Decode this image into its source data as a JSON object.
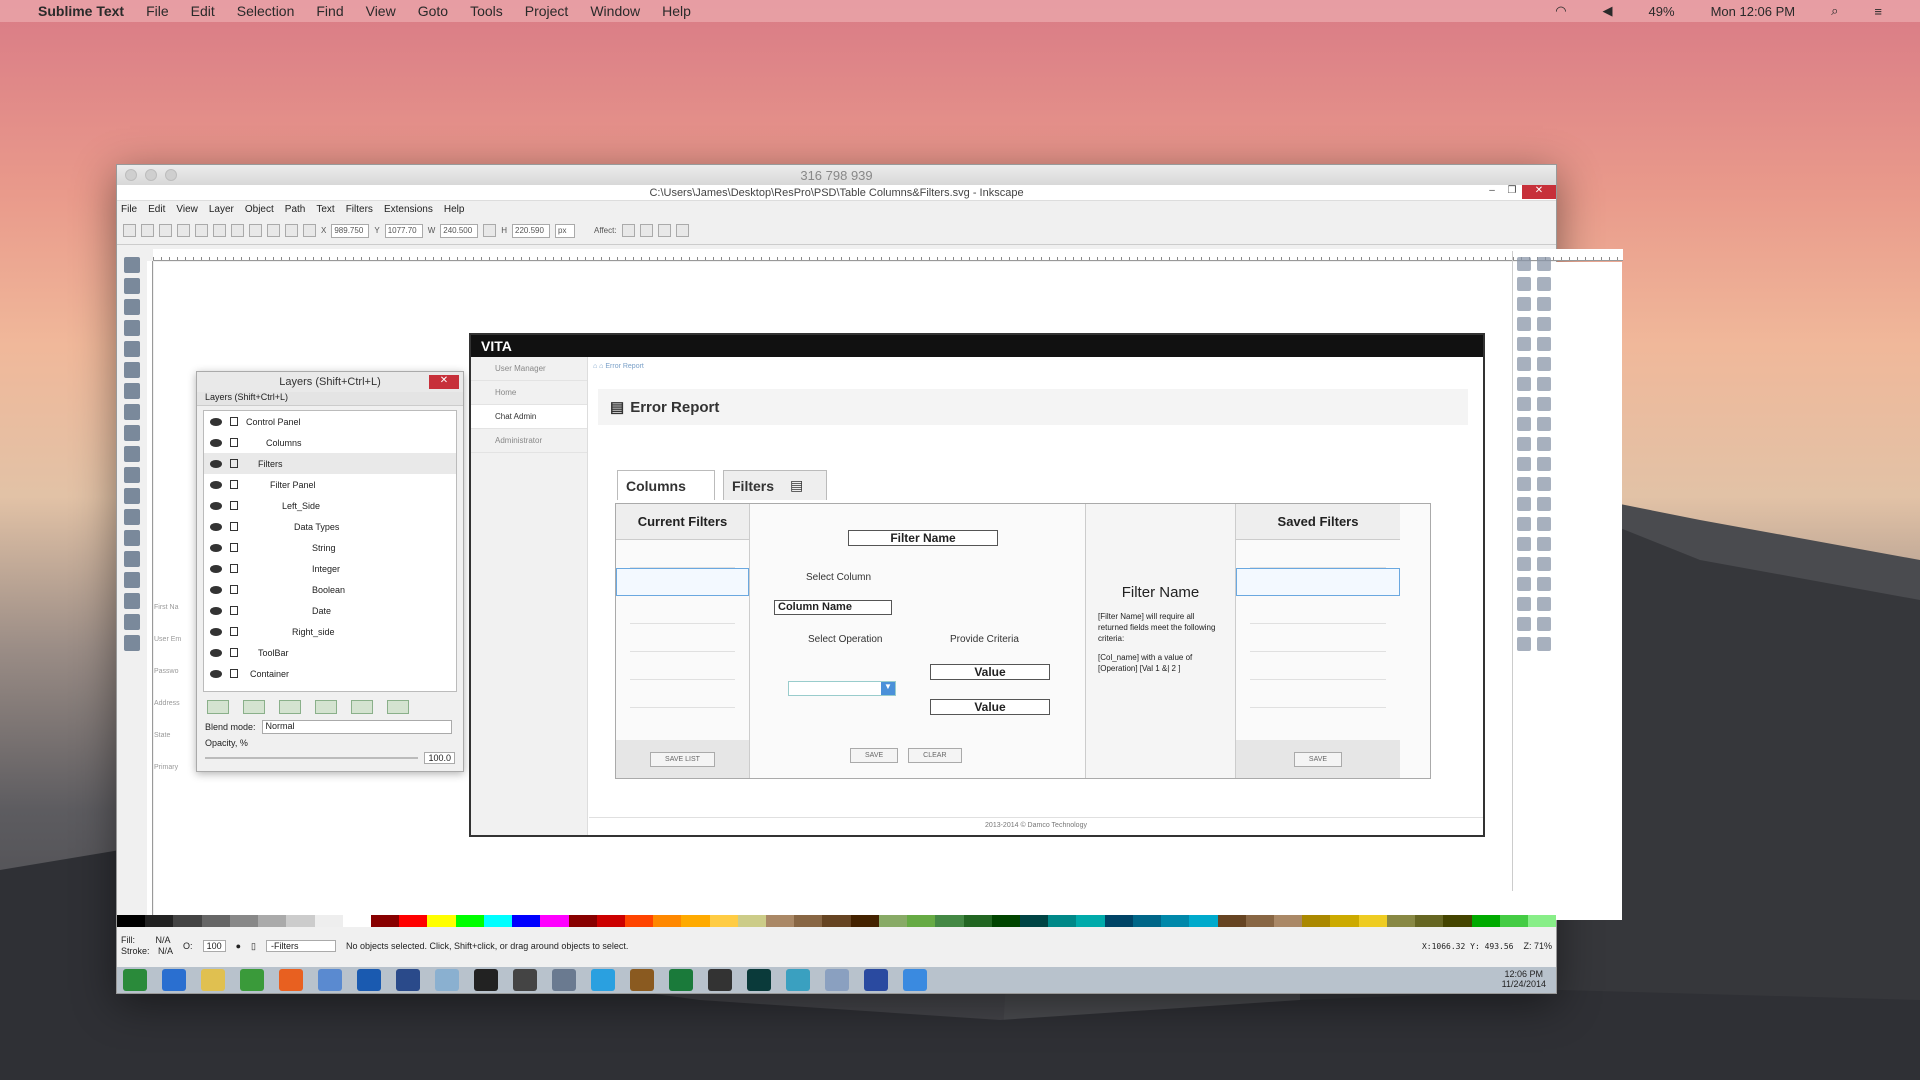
{
  "menubar": {
    "app": "Sublime Text",
    "items": [
      "File",
      "Edit",
      "Selection",
      "Find",
      "View",
      "Goto",
      "Tools",
      "Project",
      "Window",
      "Help"
    ],
    "battery": "49%",
    "clock": "Mon 12:06 PM"
  },
  "window": {
    "title": "316 798 939",
    "inkscape_title": "C:\\Users\\James\\Desktop\\ResPro\\PSD\\Table Columns&Filters.svg - Inkscape",
    "menu": [
      "File",
      "Edit",
      "View",
      "Layer",
      "Object",
      "Path",
      "Text",
      "Filters",
      "Extensions",
      "Help"
    ],
    "toolbar": {
      "x": "989.750",
      "y": "1077.70",
      "w": "240.500",
      "h": "220.590",
      "unit": "px",
      "affect": "Affect:"
    }
  },
  "layers": {
    "title": "Layers (Shift+Ctrl+L)",
    "subtitle": "Layers (Shift+Ctrl+L)",
    "rows": [
      "Control Panel",
      "Columns",
      "Filters",
      "Filter Panel",
      "Left_Side",
      "Data Types",
      "String",
      "Integer",
      "Boolean",
      "Date",
      "Right_side",
      "ToolBar",
      "Container"
    ],
    "blend_label": "Blend mode:",
    "blend_value": "Normal",
    "opacity_label": "Opacity, %",
    "opacity_value": "100.0"
  },
  "canvas_labels": [
    "First Na",
    "User Em",
    "Passwo",
    "Address",
    "State",
    "Primary"
  ],
  "art": {
    "brand": "VITA",
    "sidebar": [
      "User Manager",
      "Home",
      "Chat Admin",
      "Administrator"
    ],
    "crumb": "Error Report",
    "heading": "Error Report",
    "tabs": [
      "Columns",
      "Filters"
    ],
    "current_filters": "Current Filters",
    "saved_filters": "Saved Filters",
    "filter_name": "Filter Name",
    "select_column": "Select Column",
    "column_name": "Column Name",
    "select_operation": "Select Operation",
    "provide_criteria": "Provide Criteria",
    "value": "Value",
    "save_list": "SAVE LIST",
    "save": "SAVE",
    "clear": "CLEAR",
    "preview_title": "Filter Name",
    "preview_text": "[Filter Name] will require all returned fields meet the following criteria:",
    "preview_text2": "[Col_name] with a value of [Operation] [Val 1 &| 2 ]",
    "footer": "2013-2014 © Damco Technology"
  },
  "status": {
    "fill": "Fill:",
    "fill_v": "N/A",
    "stroke": "Stroke:",
    "stroke_v": "N/A",
    "o": "O:",
    "o_v": "100",
    "layer": "-Filters",
    "msg": "No objects selected. Click, Shift+click, or drag around objects to select.",
    "xy": "X:1066.32  Y: 493.56",
    "zoom": "Z: 71%"
  },
  "taskbar": {
    "time": "12:06 PM",
    "date": "11/24/2014"
  }
}
